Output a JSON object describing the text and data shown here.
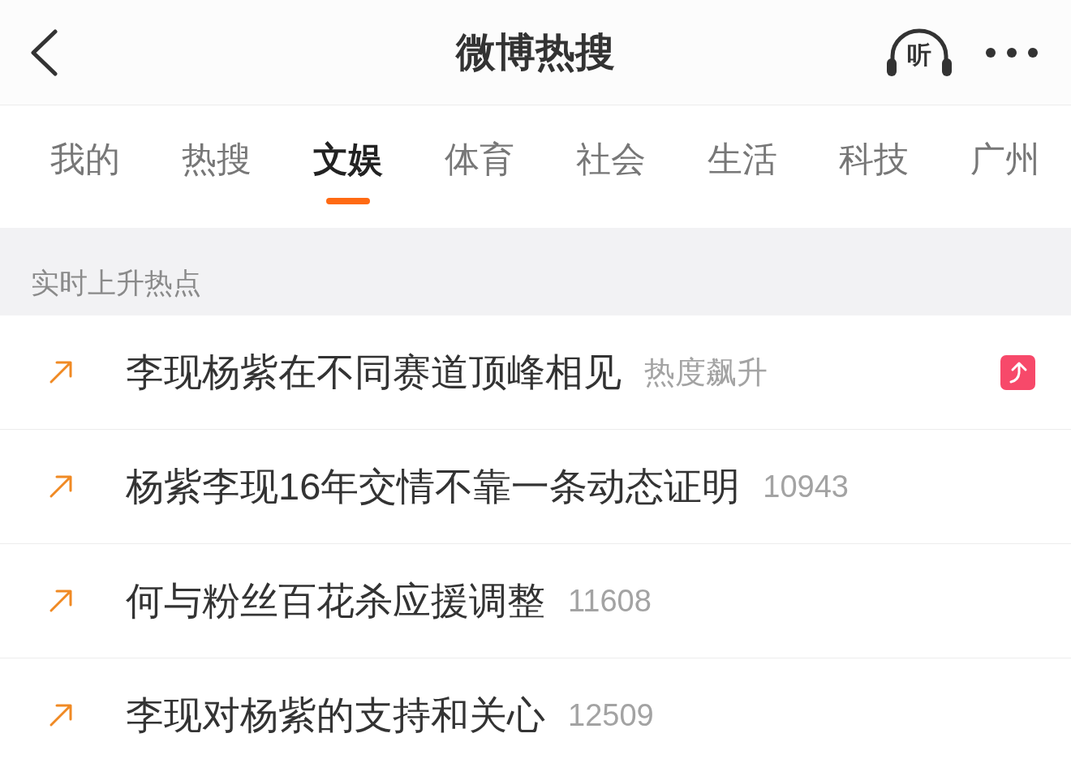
{
  "header": {
    "title": "微博热搜",
    "listen_label": "听"
  },
  "tabs": [
    {
      "label": "我的",
      "selected": false
    },
    {
      "label": "热搜",
      "selected": false
    },
    {
      "label": "文娱",
      "selected": true
    },
    {
      "label": "体育",
      "selected": false
    },
    {
      "label": "社会",
      "selected": false
    },
    {
      "label": "生活",
      "selected": false
    },
    {
      "label": "科技",
      "selected": false
    },
    {
      "label": "广州",
      "selected": false
    }
  ],
  "section": {
    "title": "实时上升热点"
  },
  "items": [
    {
      "title": "李现杨紫在不同赛道顶峰相见",
      "meta": "热度飙升",
      "rising_badge": true
    },
    {
      "title": "杨紫李现16年交情不靠一条动态证明",
      "meta": "10943",
      "rising_badge": false
    },
    {
      "title": "何与粉丝百花杀应援调整",
      "meta": "11608",
      "rising_badge": false
    },
    {
      "title": "李现对杨紫的支持和关心",
      "meta": "12509",
      "rising_badge": false
    }
  ]
}
